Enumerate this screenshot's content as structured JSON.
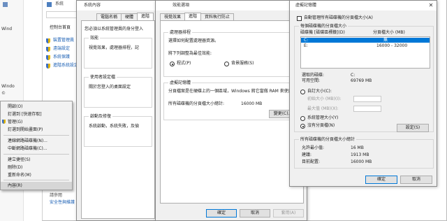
{
  "bg": {
    "header_item": "系統",
    "search_hint": "搜",
    "nav_items": [
      "控制台首頁",
      "裝置管理員",
      "遠端設定",
      "系統保護",
      "進階系統設定"
    ],
    "see_also": "請參閱",
    "bottom_items": [
      "安全性與維護"
    ],
    "left_snippets": [
      "Wind",
      "Windo",
      "©"
    ]
  },
  "sysprops": {
    "title": "系統內容",
    "tabs": [
      "電腦名稱",
      "硬體",
      "進階",
      "系統保護",
      "遠端"
    ],
    "admin_note": "您必須以系統管理員的身分登入",
    "perf_group": "效能",
    "perf_desc": "視覺效果，處理器排程，記",
    "profile_group": "使用者設定檔",
    "profile_desc": "關於您登入的桌面設定",
    "startup_group": "啟動及修復",
    "startup_desc": "系統啟動，系統失敗，及偵"
  },
  "perfopts": {
    "title": "效能選項",
    "tabs": [
      "視覺效果",
      "進階",
      "資料執行防止"
    ],
    "sched_group": "處理器排程",
    "sched_desc": "選擇如何配置處理器資源。",
    "sched_adjust": "將下列調整為最佳效能:",
    "opt_programs": "程式(P)",
    "opt_background": "背景服務(S)",
    "vm_group": "虛擬記憶體",
    "vm_desc1": "分頁檔案是在硬碟上的一個區域，Windows 將它當做 RAM 來使用。",
    "vm_total_label": "所有磁碟機的分頁檔大小總計:",
    "vm_total_value": "16000 MB",
    "change_btn": "變更(C)...",
    "ok_btn": "確定",
    "cancel_btn": "取消",
    "apply_btn": "套用(A)"
  },
  "vmdlg": {
    "title": "虛擬記憶體",
    "auto_manage": "自動管理所有磁碟機的分頁檔大小(A)",
    "per_drive": "每個磁碟機的分頁檔大小",
    "col_drive": "磁碟機 [磁碟區標籤](D)",
    "col_size": "分頁檔大小 (MB)",
    "drives": [
      {
        "drive": "C:",
        "size": "無"
      },
      {
        "drive": "E:",
        "size": "16000 - 32000"
      }
    ],
    "selected_label": "選取的磁碟:",
    "selected_value": "C:",
    "avail_label": "可用空間:",
    "avail_value": "69769 MB",
    "custom_size": "自訂大小(C):",
    "initial_size": "初始大小 (MB)(I):",
    "max_size": "最大值 (MB)(X):",
    "system_managed": "系統管理大小(Y)",
    "no_paging": "沒有分頁檔(N)",
    "set_btn": "設定(S)",
    "total_group": "所有磁碟機的分頁檔大小總計",
    "min_label": "允許最小值:",
    "min_value": "16 MB",
    "rec_label": "建議:",
    "rec_value": "1913 MB",
    "cur_label": "目前配置:",
    "cur_value": "16000 MB",
    "ok_btn": "確定",
    "cancel_btn": "取消"
  },
  "context_menu": {
    "items": [
      "開啟(O)",
      "釘選到 [快速存取]",
      "管理(G)",
      "釘選到開始畫面(P)",
      "連線網路磁碟機(N)...",
      "中斷網路磁碟機(C)...",
      "建立捷徑(S)",
      "刪除(D)",
      "重新命名(M)",
      "內容(R)"
    ]
  }
}
